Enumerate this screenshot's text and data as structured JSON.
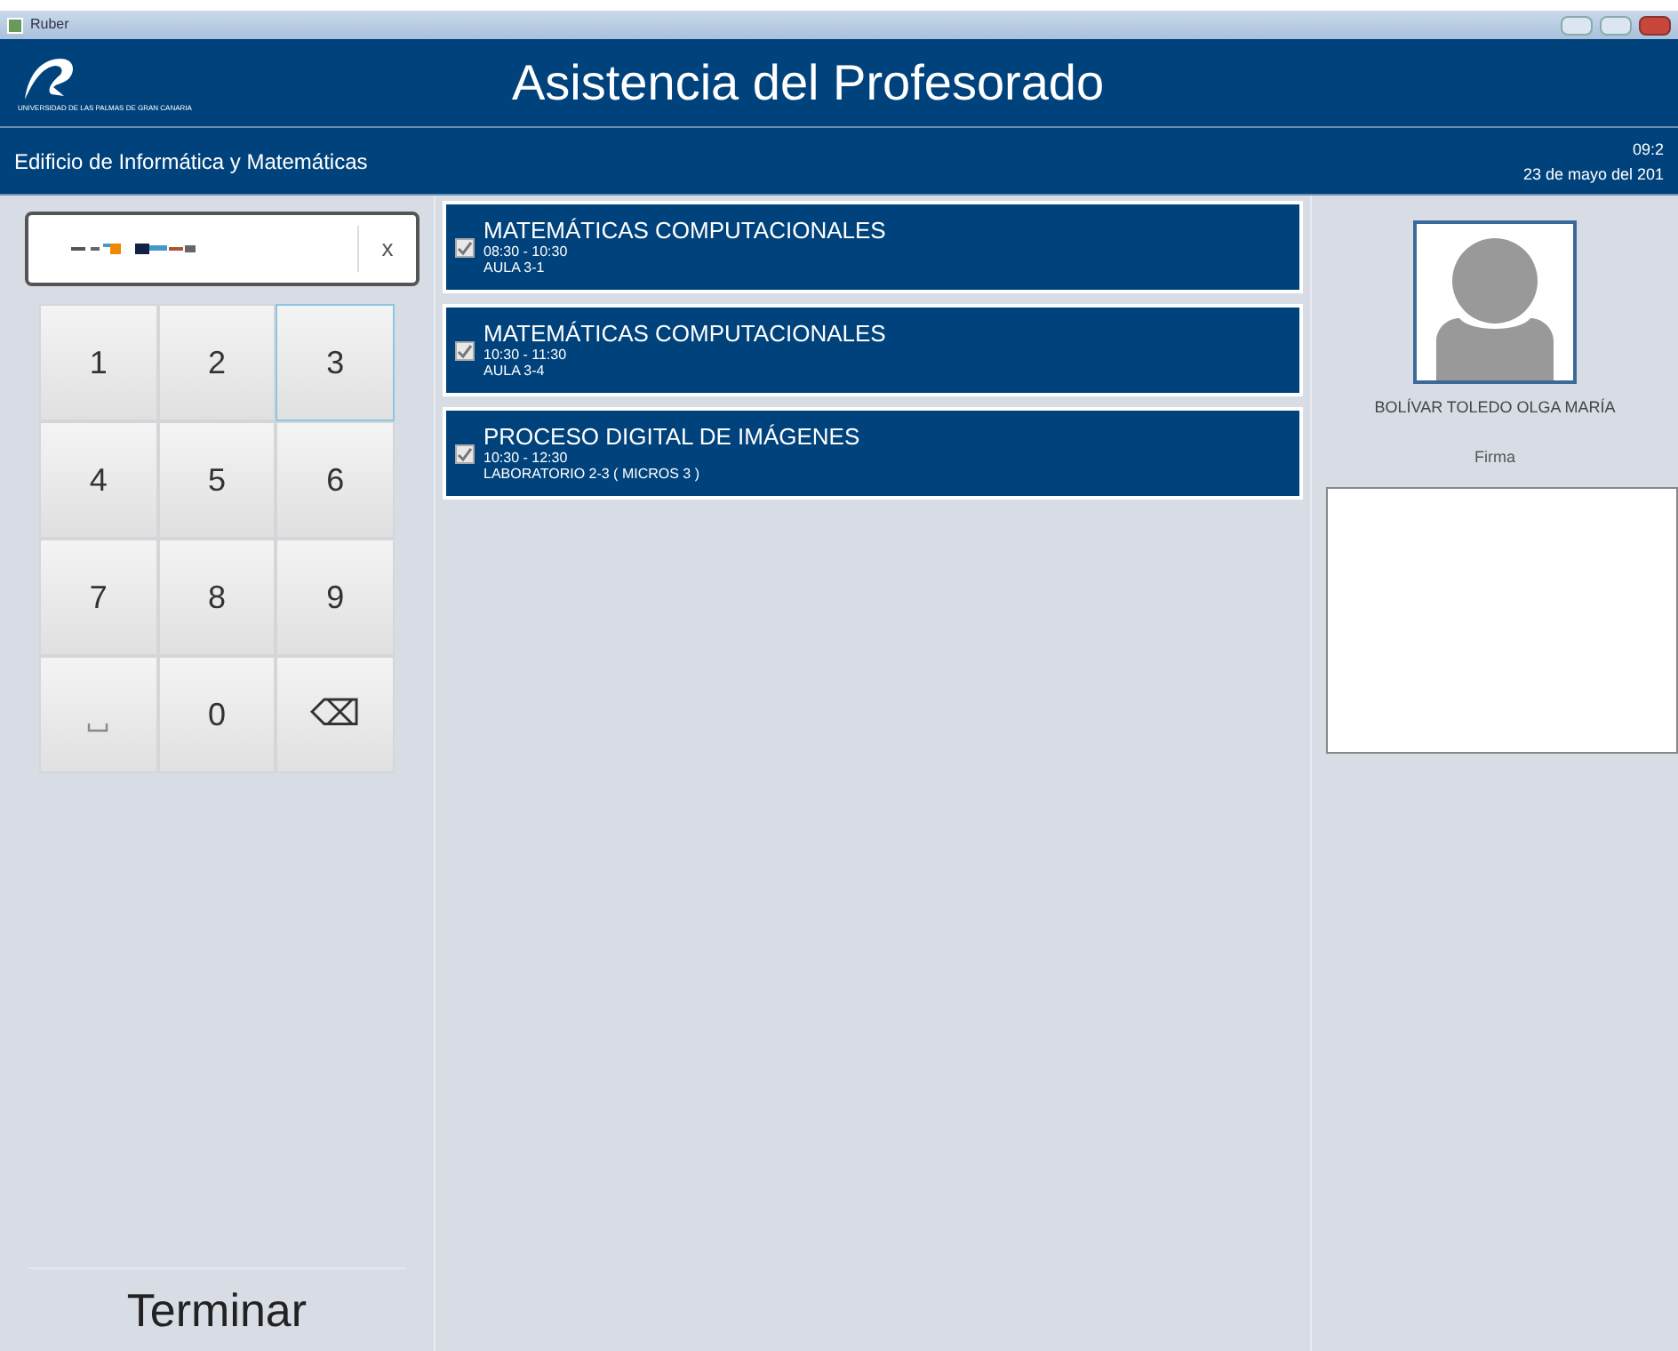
{
  "window": {
    "title": "Ruber"
  },
  "header": {
    "logo_caption": "UNIVERSIDAD DE LAS PALMAS DE GRAN CANARIA",
    "title": "Asistencia del Profesorado"
  },
  "subheader": {
    "building": "Edificio de Informática y Matemáticas",
    "time": "09:2",
    "date": "23 de mayo del 201"
  },
  "id_field": {
    "clear": "x"
  },
  "keypad": [
    {
      "label": "1",
      "kind": "digit",
      "selected": false
    },
    {
      "label": "2",
      "kind": "digit",
      "selected": false
    },
    {
      "label": "3",
      "kind": "digit",
      "selected": true
    },
    {
      "label": "4",
      "kind": "digit",
      "selected": false
    },
    {
      "label": "5",
      "kind": "digit",
      "selected": false
    },
    {
      "label": "6",
      "kind": "digit",
      "selected": false
    },
    {
      "label": "7",
      "kind": "digit",
      "selected": false
    },
    {
      "label": "8",
      "kind": "digit",
      "selected": false
    },
    {
      "label": "9",
      "kind": "digit",
      "selected": false
    },
    {
      "kind": "space",
      "selected": false
    },
    {
      "label": "0",
      "kind": "digit",
      "selected": false
    },
    {
      "label": "⌫",
      "kind": "backspace",
      "selected": false
    }
  ],
  "finish_button": "Terminar",
  "classes": [
    {
      "subject": "MATEMÁTICAS COMPUTACIONALES",
      "time": "08:30 - 10:30",
      "room": "AULA 3-1",
      "checked": true
    },
    {
      "subject": "MATEMÁTICAS COMPUTACIONALES",
      "time": "10:30 - 11:30",
      "room": "AULA 3-4",
      "checked": true
    },
    {
      "subject": "PROCESO DIGITAL DE IMÁGENES",
      "time": "10:30 - 12:30",
      "room": "LABORATORIO 2-3 ( MICROS 3 )",
      "checked": true
    }
  ],
  "teacher": {
    "name": "BOLÍVAR TOLEDO OLGA MARÍA",
    "signature_label": "Firma"
  }
}
